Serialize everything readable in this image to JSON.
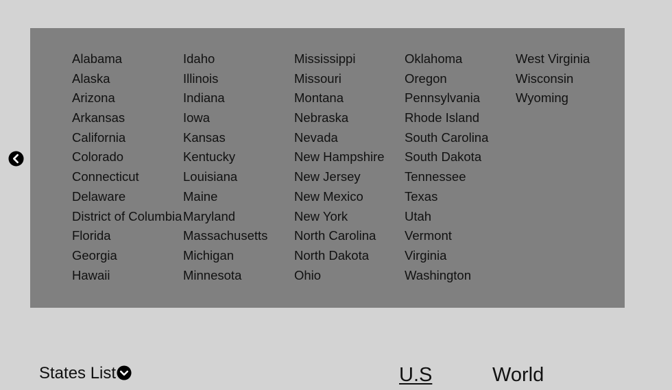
{
  "states": {
    "columns": [
      [
        "Alabama",
        "Alaska",
        "Arizona",
        "Arkansas",
        "California",
        "Colorado",
        "Connecticut",
        "Delaware",
        "District of Columbia",
        "Florida",
        "Georgia",
        "Hawaii"
      ],
      [
        "Idaho",
        "Illinois",
        "Indiana",
        "Iowa",
        "Kansas",
        "Kentucky",
        "Louisiana",
        "Maine",
        "Maryland",
        "Massachusetts",
        "Michigan",
        "Minnesota"
      ],
      [
        "Mississippi",
        "Missouri",
        "Montana",
        "Nebraska",
        "Nevada",
        "New Hampshire",
        "New Jersey",
        "New Mexico",
        "New York",
        "North Carolina",
        "North Dakota",
        "Ohio"
      ],
      [
        "Oklahoma",
        "Oregon",
        "Pennsylvania",
        "Rhode Island",
        "South Carolina",
        "South Dakota",
        "Tennessee",
        "Texas",
        "Utah",
        "Vermont",
        "Virginia",
        "Washington"
      ],
      [
        "West Virginia",
        "Wisconsin",
        "Wyoming"
      ]
    ]
  },
  "nav": {
    "prev_icon": "chevron-left-circle-icon"
  },
  "footer": {
    "title": "States List",
    "toggle_icon": "chevron-down-circle-icon",
    "tabs": [
      {
        "label": "U.S",
        "active": true
      },
      {
        "label": "World",
        "active": false
      }
    ]
  },
  "colors": {
    "page_background": "#d3d3d3",
    "panel_background": "#808080",
    "text": "#111111"
  }
}
